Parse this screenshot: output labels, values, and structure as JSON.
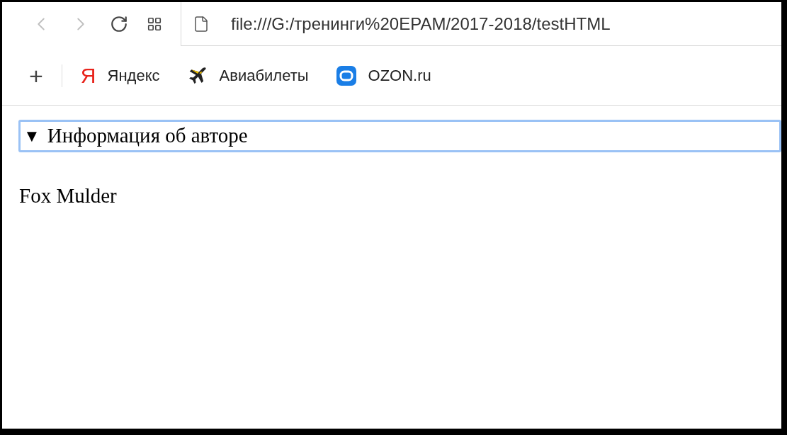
{
  "toolbar": {
    "address": "file:///G:/тренинги%20EPAM/2017-2018/testHTML"
  },
  "bookmarks_bar": {
    "add_button": "+",
    "bookmarks": [
      {
        "label": "Яндекс",
        "kind": "yandex",
        "icon_text": "Я"
      },
      {
        "label": "Авиабилеты",
        "kind": "plane"
      },
      {
        "label": "OZON.ru",
        "kind": "ozon"
      }
    ]
  },
  "page": {
    "details": {
      "marker": "▼",
      "summary": "Информация об авторе",
      "focused": true,
      "expanded": true,
      "content": "Fox Mulder"
    }
  }
}
